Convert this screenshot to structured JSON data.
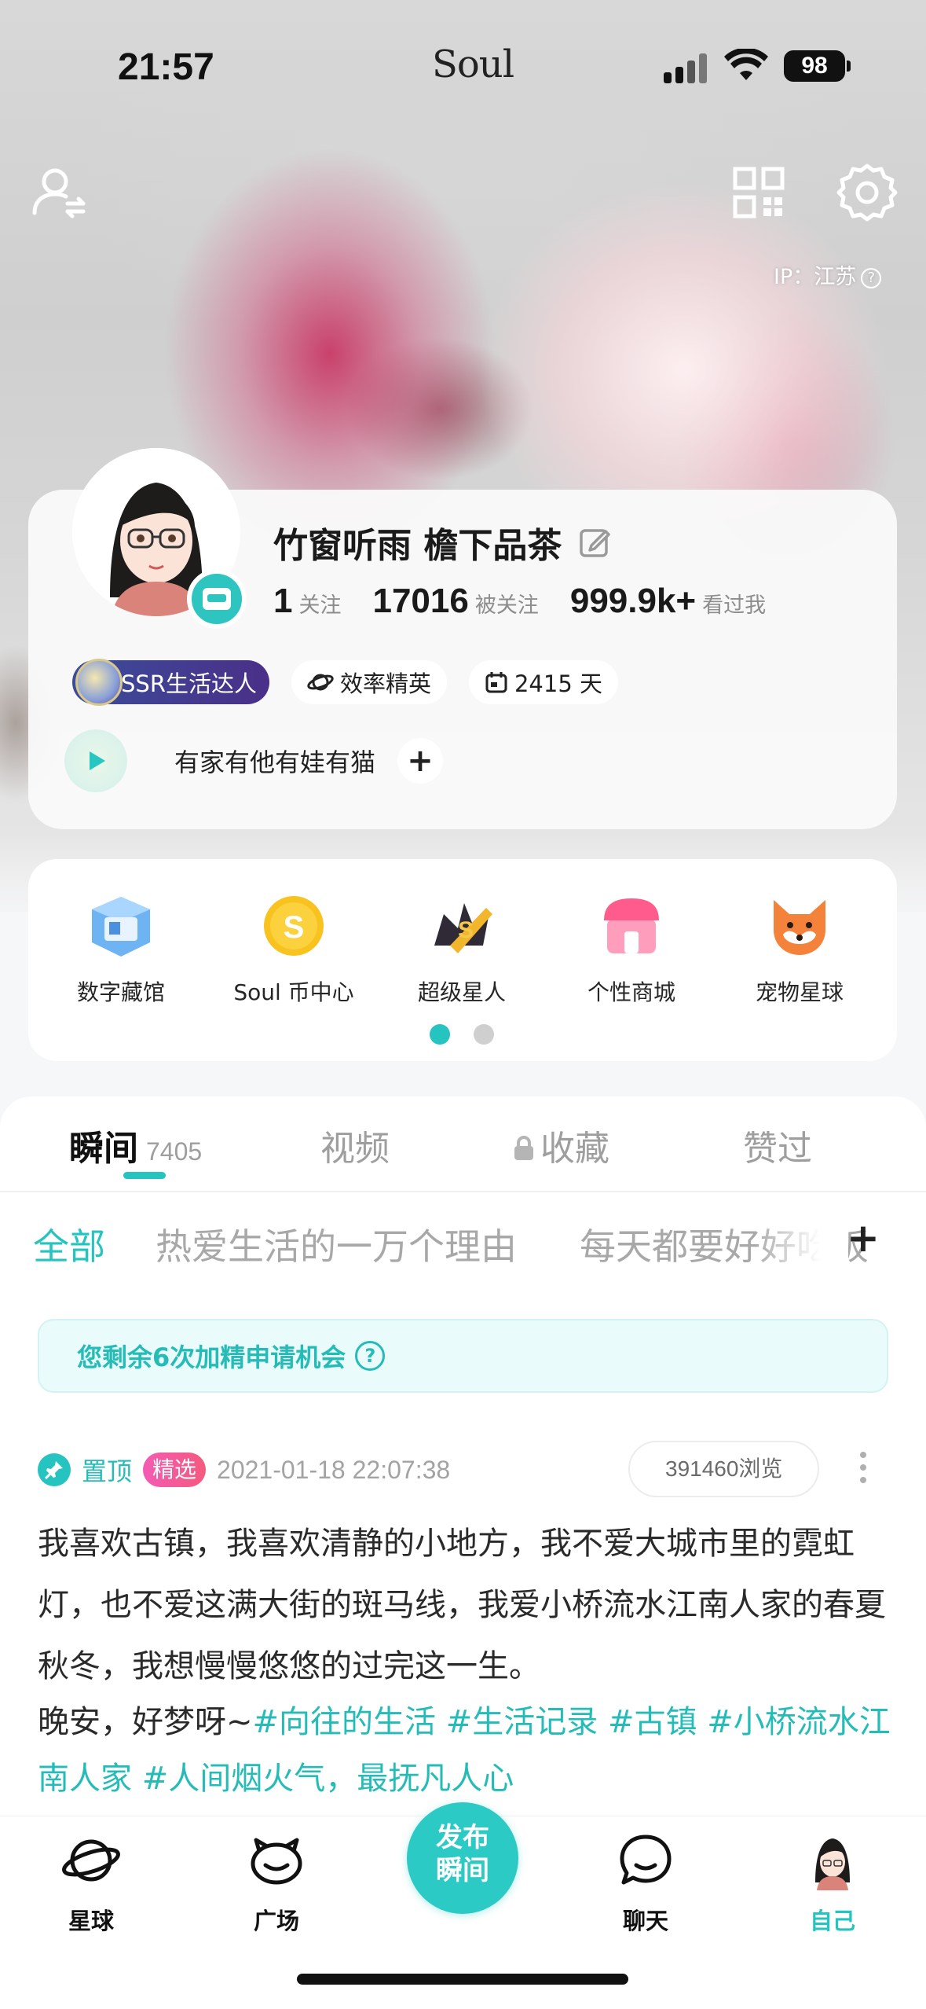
{
  "status_bar": {
    "time": "21:57",
    "app_name": "Soul",
    "battery": "98"
  },
  "header": {
    "ip_label": "IP：江苏",
    "ip_help": "?"
  },
  "profile": {
    "name": "竹窗听雨 檐下品茶",
    "stats": [
      {
        "value": "1",
        "label": "关注"
      },
      {
        "value": "17016",
        "label": "被关注"
      },
      {
        "value": "999.9k+",
        "label": "看过我"
      }
    ],
    "badges": {
      "ssr": "SSR生活达人",
      "efficiency": "效率精英",
      "days": "2415 天"
    },
    "signature": "有家有他有娃有猫",
    "signature_add": "+"
  },
  "services": {
    "items": [
      {
        "label": "数字藏馆",
        "icon": "digital-collection-icon"
      },
      {
        "label": "Soul 币中心",
        "icon": "soul-coin-icon"
      },
      {
        "label": "超级星人",
        "icon": "super-star-icon"
      },
      {
        "label": "个性商城",
        "icon": "shop-icon"
      },
      {
        "label": "宠物星球",
        "icon": "pet-fox-icon"
      }
    ],
    "page_count": 2,
    "active_page": 1
  },
  "feed": {
    "tabs": [
      {
        "label": "瞬间",
        "count": "7405"
      },
      {
        "label": "视频"
      },
      {
        "label": "收藏"
      },
      {
        "label": "赞过"
      }
    ],
    "categories": [
      "全部",
      "热爱生活的一万个理由",
      "每天都要好好吃饭"
    ],
    "category_add": "+",
    "notice": "您剩余6次加精申请机会",
    "notice_help": "?",
    "post": {
      "pinned_label": "置顶",
      "featured_label": "精选",
      "time": "2021-01-18 22:07:38",
      "views": "391460浏览",
      "body": "我喜欢古镇，我喜欢清静的小地方，我不爱大城市里的霓虹灯，也不爱这满大街的斑马线，我爱小桥流水江南人家的春夏秋冬，我想慢慢悠悠的过完这一生。",
      "greeting": "晚安，好梦呀~",
      "hashtags": [
        "#向往的生活",
        "#生活记录",
        "#古镇",
        "#小桥流水江南人家",
        "#人间烟火气，最抚凡人心"
      ]
    }
  },
  "bottom_nav": {
    "items": [
      {
        "label": "星球",
        "icon": "planet-icon"
      },
      {
        "label": "广场",
        "icon": "square-icon"
      },
      {
        "label": "聊天",
        "icon": "chat-icon"
      },
      {
        "label": "自己",
        "icon": "avatar-icon"
      }
    ],
    "post_button": [
      "发布",
      "瞬间"
    ],
    "active": "自己"
  },
  "colors": {
    "accent": "#25C4C0",
    "featured": "#F35BB3",
    "badge_ssr": "#3B4C9A"
  }
}
